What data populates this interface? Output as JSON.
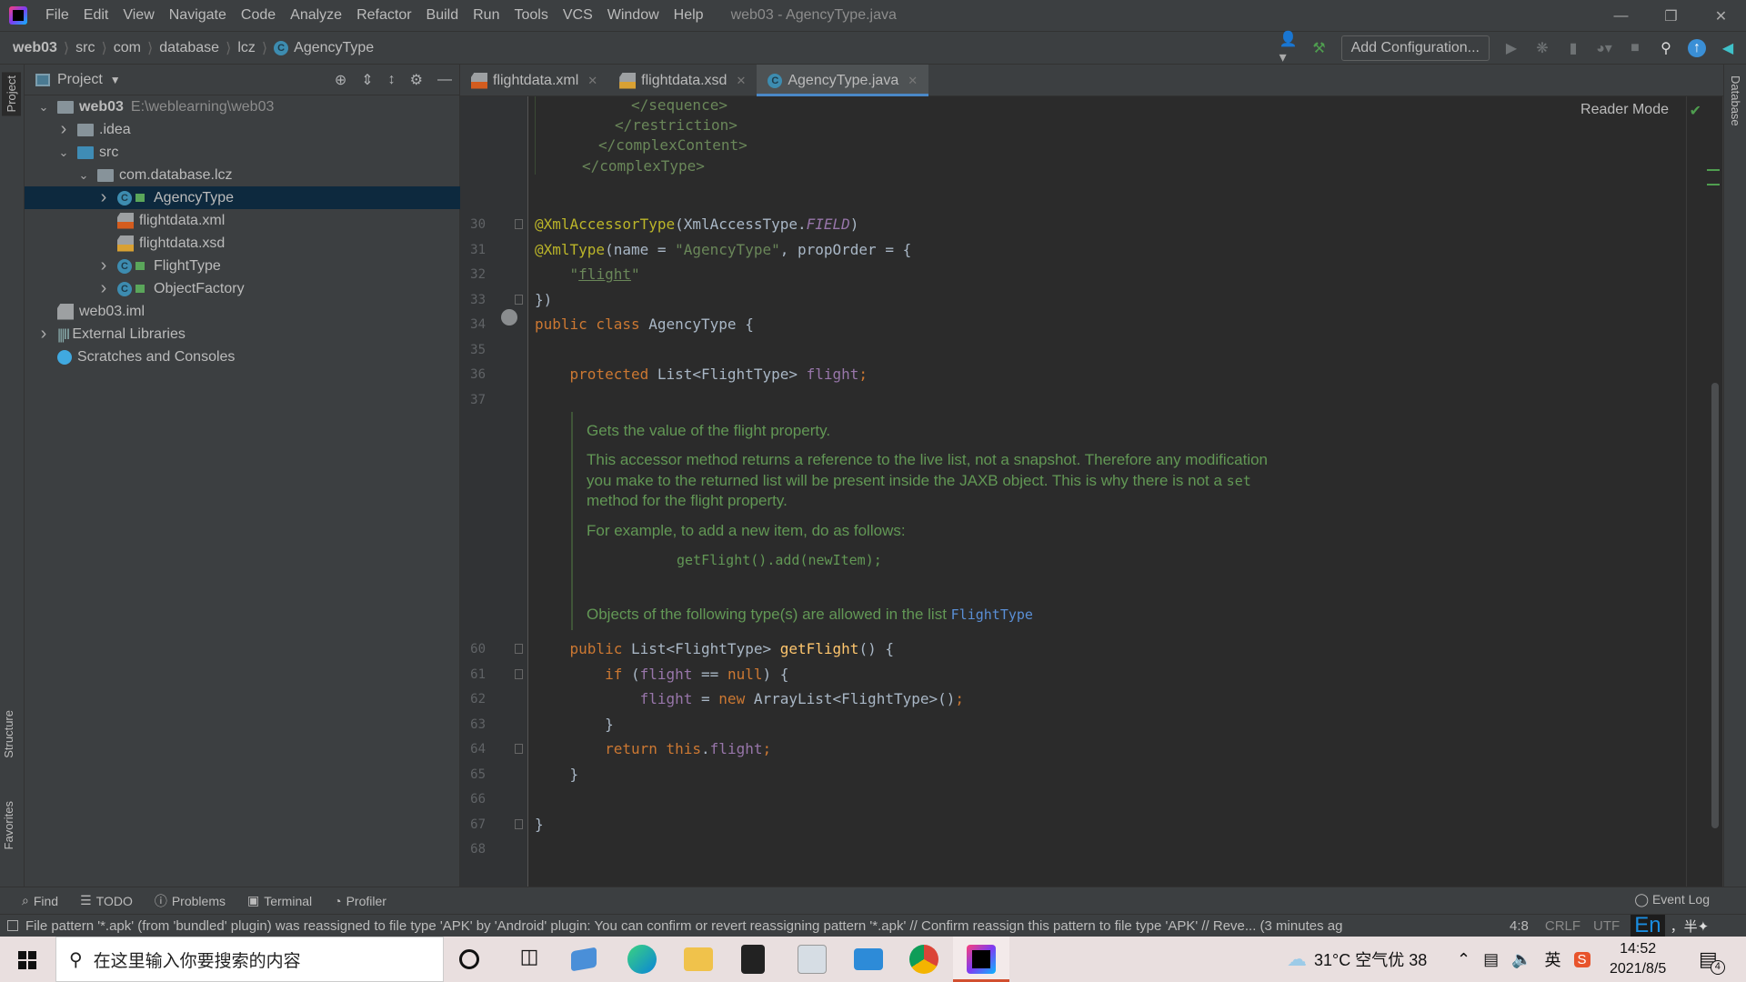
{
  "menu": {
    "items": [
      "File",
      "Edit",
      "View",
      "Navigate",
      "Code",
      "Analyze",
      "Refactor",
      "Build",
      "Run",
      "Tools",
      "VCS",
      "Window",
      "Help"
    ],
    "window_title": "web03 - AgencyType.java"
  },
  "breadcrumb": [
    "web03",
    "src",
    "com",
    "database",
    "lcz",
    "AgencyType"
  ],
  "toolbar": {
    "add_configuration": "Add Configuration..."
  },
  "left_strip": {
    "project": "Project",
    "structure": "Structure",
    "favorites": "Favorites"
  },
  "right_strip": {
    "database": "Database"
  },
  "project_panel": {
    "title": "Project",
    "tree": [
      {
        "label": "web03",
        "path": "E:\\weblearning\\web03",
        "icon": "module-folder-icon",
        "expanded": true
      },
      {
        "label": ".idea",
        "icon": "folder-icon",
        "expanded": false
      },
      {
        "label": "src",
        "icon": "source-folder-icon",
        "expanded": true
      },
      {
        "label": "com.database.lcz",
        "icon": "package-icon",
        "expanded": true
      },
      {
        "label": "AgencyType",
        "icon": "class-icon",
        "expanded": false,
        "selected": true
      },
      {
        "label": "flightdata.xml",
        "icon": "xml-file-icon"
      },
      {
        "label": "flightdata.xsd",
        "icon": "xsd-file-icon"
      },
      {
        "label": "FlightType",
        "icon": "class-icon",
        "expanded": false
      },
      {
        "label": "ObjectFactory",
        "icon": "class-icon",
        "expanded": false
      },
      {
        "label": "web03.iml",
        "icon": "iml-file-icon"
      },
      {
        "label": "External Libraries",
        "icon": "library-icon",
        "expanded": false
      },
      {
        "label": "Scratches and Consoles",
        "icon": "scratches-icon"
      }
    ]
  },
  "tabs": [
    {
      "label": "flightdata.xml",
      "active": false
    },
    {
      "label": "flightdata.xsd",
      "active": false
    },
    {
      "label": "AgencyType.java",
      "active": true
    }
  ],
  "editor": {
    "reader_mode": "Reader Mode",
    "xml_lines": [
      "</sequence>",
      "</restriction>",
      "</complexContent>",
      "</complexType>"
    ],
    "lines_top": [
      {
        "n": "30",
        "tokens": [
          [
            "@XmlAccessorType",
            "a"
          ],
          [
            "(XmlAccessType.",
            ""
          ],
          [
            "FIELD",
            "fi"
          ],
          [
            ")",
            ""
          ]
        ]
      },
      {
        "n": "31",
        "tokens": [
          [
            "@XmlType",
            "a"
          ],
          [
            "(name = ",
            ""
          ],
          [
            "\"AgencyType\"",
            "s"
          ],
          [
            ", propOrder = {",
            ""
          ]
        ]
      },
      {
        "n": "32",
        "tokens": [
          [
            "    ",
            ""
          ],
          [
            "\"",
            "s"
          ],
          [
            "flight",
            "s u"
          ],
          [
            "\"",
            "s"
          ]
        ]
      },
      {
        "n": "33",
        "tokens": [
          [
            "})",
            ""
          ]
        ]
      },
      {
        "n": "34",
        "tokens": [
          [
            "public class ",
            "k"
          ],
          [
            "AgencyType {",
            ""
          ]
        ]
      },
      {
        "n": "35",
        "tokens": []
      },
      {
        "n": "36",
        "tokens": [
          [
            "    ",
            ""
          ],
          [
            "protected ",
            "k"
          ],
          [
            "List<FlightType> ",
            ""
          ],
          [
            "flight",
            "f"
          ],
          [
            ";",
            "k"
          ]
        ]
      },
      {
        "n": "37",
        "tokens": []
      }
    ],
    "doc": {
      "p1": "Gets the value of the flight property.",
      "p2a": "This accessor method returns a reference to the live list, not a snapshot. Therefore any modification",
      "p2b": "you make to the returned list will be present inside the JAXB object. This is why there is not a",
      "p2b_code": "set",
      "p2c": "method for the flight property.",
      "p3": "For example, to add a new item, do as follows:",
      "example": "getFlight().add(newItem);",
      "p4": "Objects of the following type(s) are allowed in the list",
      "p4_link": "FlightType"
    },
    "lines_bottom": [
      {
        "n": "60",
        "tokens": [
          [
            "    ",
            ""
          ],
          [
            "public ",
            "k"
          ],
          [
            "List<FlightType> ",
            ""
          ],
          [
            "getFlight",
            "a2"
          ],
          [
            "() {",
            ""
          ]
        ]
      },
      {
        "n": "61",
        "tokens": [
          [
            "        ",
            ""
          ],
          [
            "if ",
            "k"
          ],
          [
            "(",
            ""
          ],
          [
            "flight",
            "f"
          ],
          [
            " == ",
            ""
          ],
          [
            "null",
            "k"
          ],
          [
            ") {",
            ""
          ]
        ]
      },
      {
        "n": "62",
        "tokens": [
          [
            "            ",
            ""
          ],
          [
            "flight",
            "f"
          ],
          [
            " = ",
            ""
          ],
          [
            "new ",
            "k"
          ],
          [
            "ArrayList<FlightType>()",
            ""
          ],
          [
            ";",
            "k"
          ]
        ]
      },
      {
        "n": "63",
        "tokens": [
          [
            "        }",
            ""
          ]
        ]
      },
      {
        "n": "64",
        "tokens": [
          [
            "        ",
            ""
          ],
          [
            "return this",
            "k"
          ],
          [
            ".",
            ""
          ],
          [
            "flight",
            "f"
          ],
          [
            ";",
            "k"
          ]
        ]
      },
      {
        "n": "65",
        "tokens": [
          [
            "    }",
            ""
          ]
        ]
      },
      {
        "n": "66",
        "tokens": []
      },
      {
        "n": "67",
        "tokens": [
          [
            "}",
            ""
          ]
        ]
      },
      {
        "n": "68",
        "tokens": []
      }
    ]
  },
  "bottom_tools": [
    "Find",
    "TODO",
    "Problems",
    "Terminal",
    "Profiler"
  ],
  "event_log": "Event Log",
  "status": {
    "message": "File pattern '*.apk' (from 'bundled' plugin) was reassigned to file type 'APK' by 'Android' plugin: You can confirm or revert reassigning pattern '*.apk' // Confirm reassign this pattern to file type 'APK' // Reve... (3 minutes ag",
    "position": "4:8",
    "line_sep": "CRLF",
    "encoding": "UTF",
    "ime": "En"
  },
  "taskbar": {
    "search_placeholder": "在这里输入你要搜索的内容",
    "weather": "31°C 空气优 38",
    "ime": "英",
    "time": "14:52",
    "date": "2021/8/5",
    "notifications": "4"
  },
  "colors": {
    "editor_bg": "#2b2b2b",
    "panel_bg": "#3c3f41",
    "keyword": "#cc7832",
    "annotation": "#bbb529",
    "string": "#6a8759",
    "field": "#9876aa",
    "doc": "#629755",
    "selection": "#0d293e",
    "accent": "#4a88c7"
  }
}
